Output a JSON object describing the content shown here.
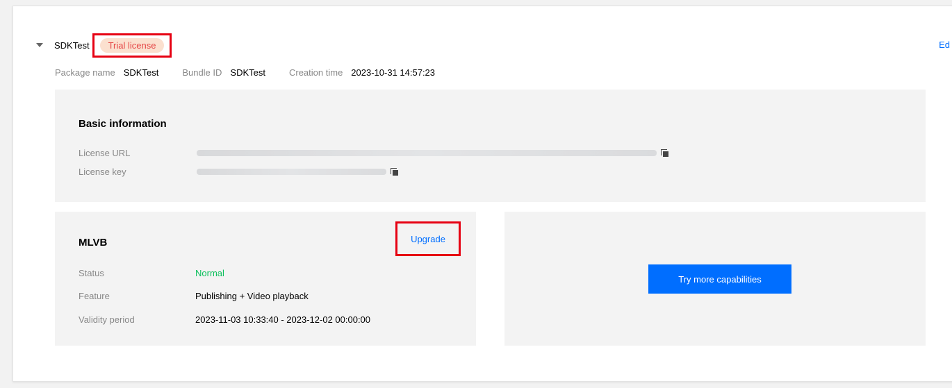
{
  "app": {
    "name": "SDKTest",
    "badge": "Trial license",
    "edit_label": "Ed"
  },
  "meta": {
    "package_label": "Package name",
    "package_value": "SDKTest",
    "bundle_label": "Bundle ID",
    "bundle_value": "SDKTest",
    "creation_label": "Creation time",
    "creation_value": "2023-10-31 14:57:23"
  },
  "basic": {
    "title": "Basic information",
    "license_url_label": "License URL",
    "license_key_label": "License key"
  },
  "mlvb": {
    "title": "MLVB",
    "upgrade_label": "Upgrade",
    "status_label": "Status",
    "status_value": "Normal",
    "feature_label": "Feature",
    "feature_value": "Publishing + Video playback",
    "validity_label": "Validity period",
    "validity_value": "2023-11-03 10:33:40 - 2023-12-02 00:00:00"
  },
  "more": {
    "button_label": "Try more capabilities"
  },
  "colors": {
    "accent": "#006eff",
    "highlight": "#e60012",
    "badge_bg": "#fbe0cf",
    "badge_text": "#e54545",
    "status_ok": "#0abf5b"
  }
}
